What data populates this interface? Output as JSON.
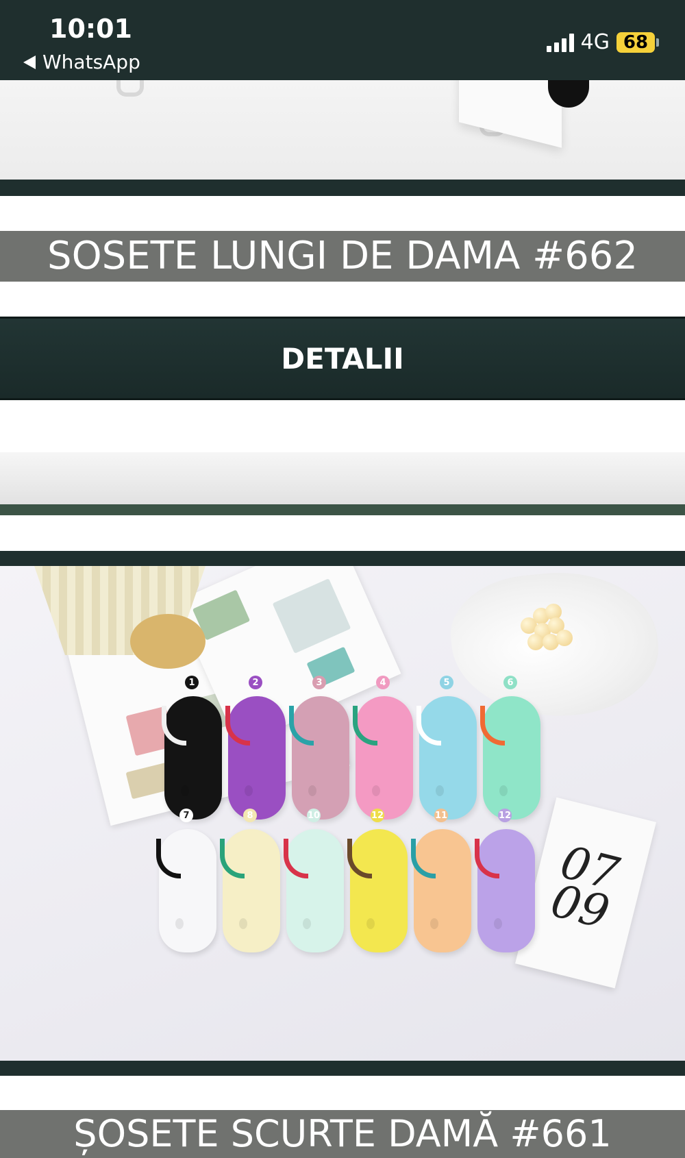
{
  "status_bar": {
    "time": "10:01",
    "back_app": "WhatsApp",
    "network": "4G",
    "battery": "68"
  },
  "listing": {
    "title_1": "SOSETE LUNGI DE DAMA #662",
    "details_label": "DETALII",
    "title_2": "ȘOSETE SCURTE DAMĂ #661"
  },
  "photo": {
    "card_text": "07\n09",
    "sock_numbers": [
      "1",
      "2",
      "3",
      "4",
      "5",
      "6",
      "7",
      "8",
      "10",
      "12",
      "11",
      "12"
    ]
  },
  "colors": {
    "dark_bar": "#1f2f2e",
    "title_banner": "#70726f",
    "accent_green": "#3c5446",
    "battery": "#f5d13a"
  }
}
